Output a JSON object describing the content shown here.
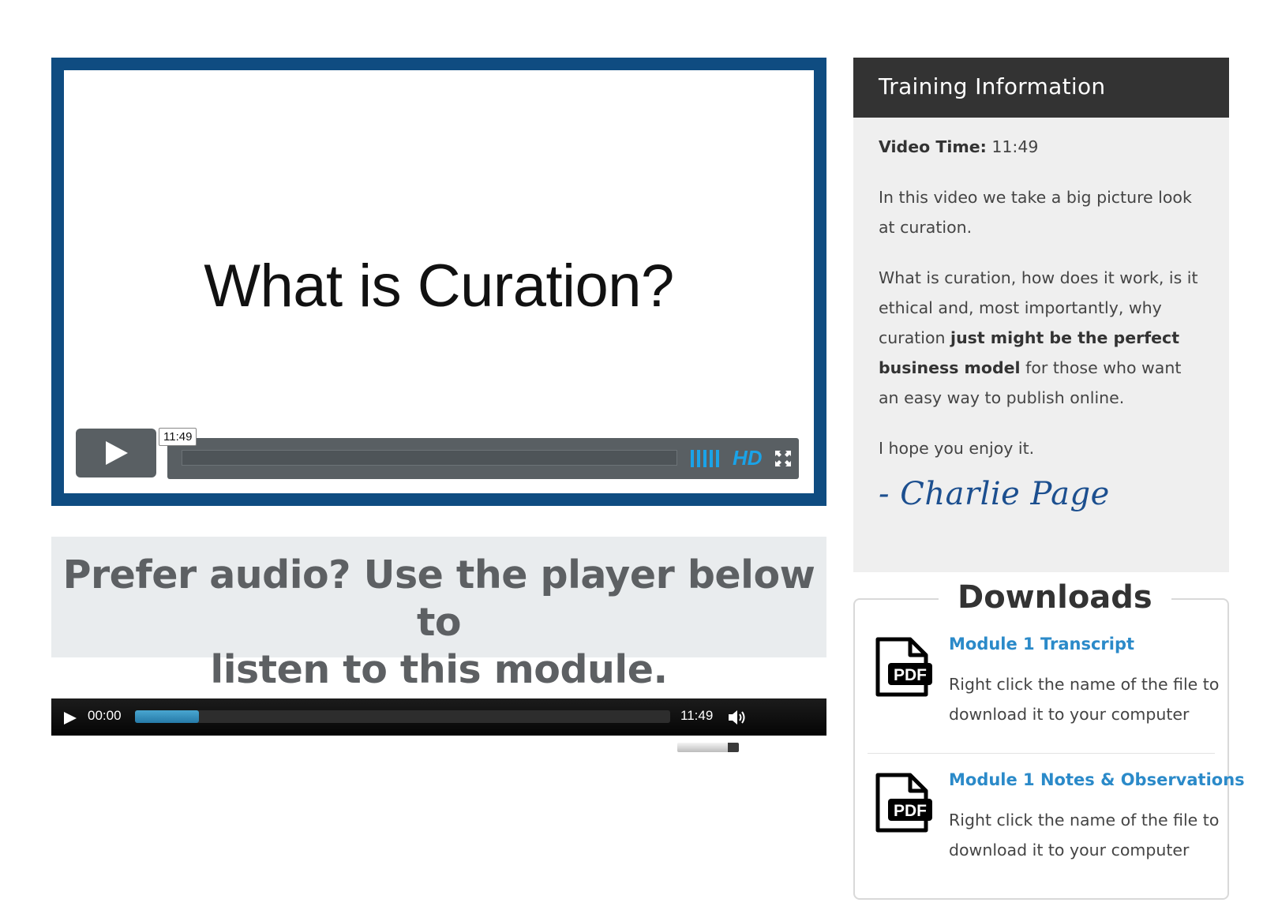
{
  "video": {
    "slide_title": "What is Curation?",
    "tooltip_time": "11:49",
    "hd_label": "HD",
    "icons": {
      "play": "play-icon",
      "volume": "volume-bars-icon",
      "fullscreen": "fullscreen-icon"
    },
    "colors": {
      "frame": "#0f4c81",
      "accent": "#1aa3e8",
      "controls": "#595f63"
    }
  },
  "audio_prompt": {
    "line1": "Prefer audio? Use the player below to",
    "line2": "listen to this module."
  },
  "audio_player": {
    "current_time": "00:00",
    "duration": "11:49",
    "loaded_fraction": 0.12,
    "volume_fraction": 0.82,
    "icons": {
      "play": "play-icon",
      "speaker": "speaker-icon"
    }
  },
  "training": {
    "header": "Training Information",
    "video_time_label": "Video Time:",
    "video_time_value": "11:49",
    "para1": "In this video we take a big picture look at curation.",
    "para2_start": "What is curation, how does it work, is it ethical and, most importantly, why curation ",
    "para2_bold": "just might be the perfect business model",
    "para2_end": " for those who want an easy way to publish online.",
    "para3": "I hope you enjoy it.",
    "signature": "- Charlie Page"
  },
  "downloads": {
    "title": "Downloads",
    "items": [
      {
        "icon": "pdf-file-icon",
        "link": "Module 1 Transcript",
        "description": "Right click the name of the file to download it to your computer"
      },
      {
        "icon": "pdf-file-icon",
        "link": "Module 1 Notes & Observations",
        "description": "Right click the name of the file to download it to your computer"
      }
    ]
  }
}
